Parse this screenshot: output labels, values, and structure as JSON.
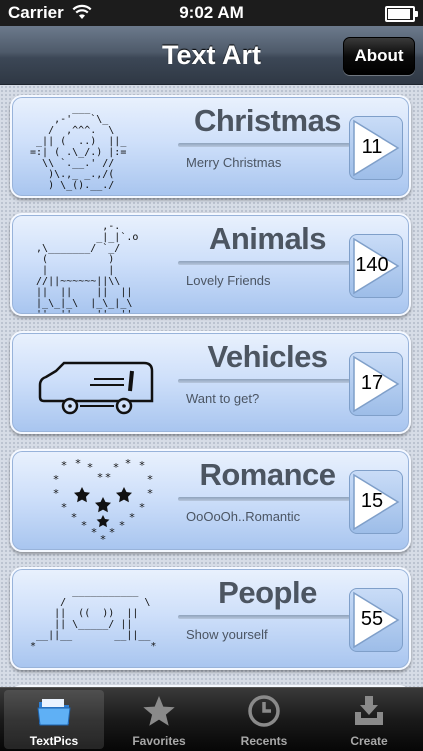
{
  "status_bar": {
    "carrier": "Carrier",
    "time": "9:02 AM"
  },
  "nav": {
    "title": "Text Art",
    "about_label": "About"
  },
  "categories": [
    {
      "title": "Christmas",
      "subtitle": "Merry Christmas",
      "count": "11",
      "icon": "santa-art"
    },
    {
      "title": "Animals",
      "subtitle": "Lovely Friends",
      "count": "140",
      "icon": "dog-art"
    },
    {
      "title": "Vehicles",
      "subtitle": "Want to get?",
      "count": "17",
      "icon": "car-art"
    },
    {
      "title": "Romance",
      "subtitle": "OoOoOh..Romantic",
      "count": "15",
      "icon": "heart-stars-art"
    },
    {
      "title": "People",
      "subtitle": "Show yourself",
      "count": "55",
      "icon": "people-art"
    }
  ],
  "tabs": [
    {
      "label": "TextPics",
      "icon": "folder-icon",
      "active": true
    },
    {
      "label": "Favorites",
      "icon": "star-icon",
      "active": false
    },
    {
      "label": "Recents",
      "icon": "clock-icon",
      "active": false
    },
    {
      "label": "Create",
      "icon": "download-tray-icon",
      "active": false
    }
  ],
  "colors": {
    "nav_bar": "#4e5a6a",
    "card": "#cfe0fa",
    "tab_bar": "#1a1a1a"
  }
}
